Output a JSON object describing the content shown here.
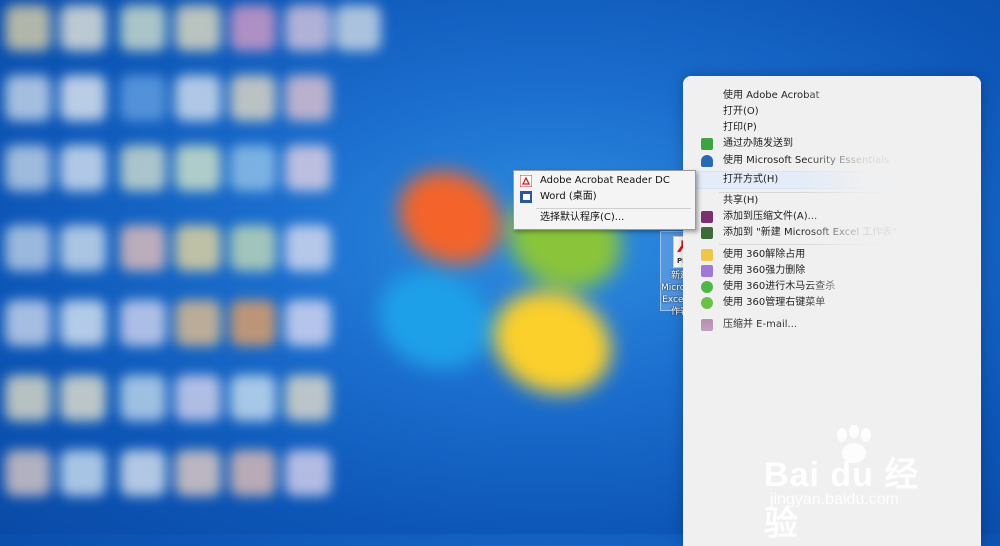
{
  "submenu": {
    "items": [
      {
        "label": "Adobe Acrobat Reader DC",
        "icon": "acrobat-icon"
      },
      {
        "label": "Word (桌面)",
        "icon": "word-icon"
      }
    ],
    "choose_default": "选择默认程序(C)..."
  },
  "context_menu": {
    "items": [
      {
        "label": "使用 Adobe Acrobat"
      },
      {
        "label": "打开(O)"
      },
      {
        "label": "打印(P)"
      },
      {
        "label": "通过办随发送到"
      },
      {
        "label": "使用 Microsoft Security Essentials"
      },
      {
        "label": "打开方式(H)"
      },
      {
        "label": "共享(H)"
      },
      {
        "label": "添加到压缩文件(A)..."
      },
      {
        "label": "添加到 \"新建 Microsoft Excel 工作表\""
      },
      {
        "label": "使用 360解除占用"
      },
      {
        "label": "使用 360强力删除"
      },
      {
        "label": "使用 360进行木马云查杀"
      },
      {
        "label": "使用 360管理右键菜单"
      },
      {
        "label": "压缩并 E-mail..."
      }
    ]
  },
  "desktop_file": {
    "label": "新建 Microsoft Excel 工作表",
    "icon_tag": "PDF"
  },
  "watermark": {
    "main": "Bai du 经验",
    "sub": "jingyan.baidu.com"
  }
}
